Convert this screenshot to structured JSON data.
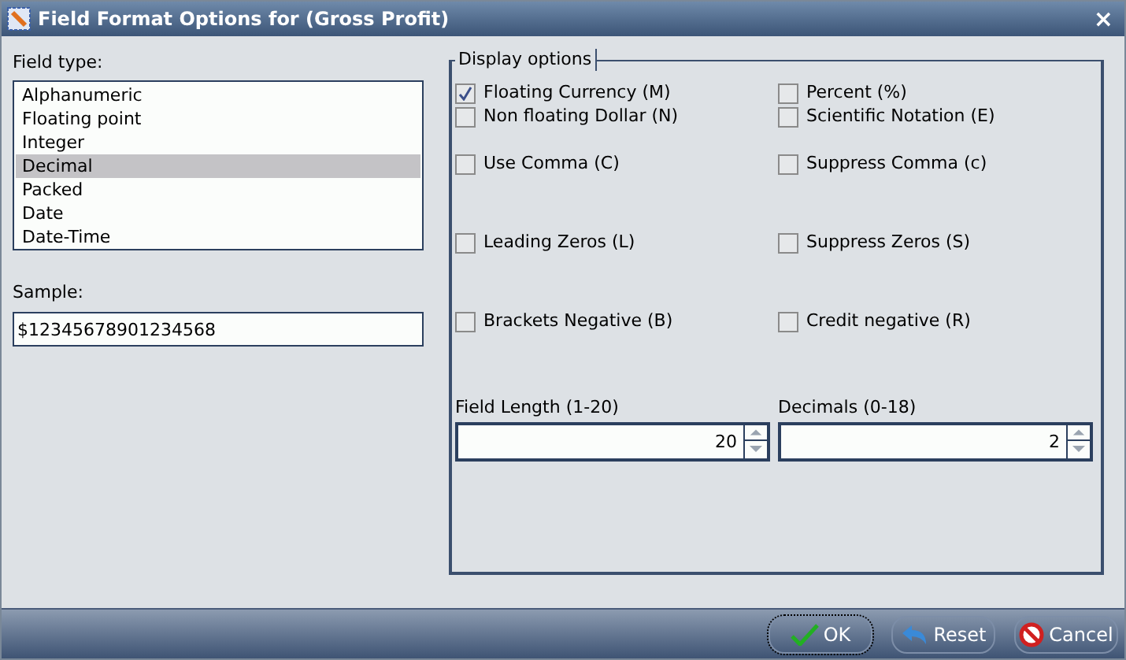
{
  "window": {
    "title": "Field Format Options for (Gross Profit)",
    "close": "×"
  },
  "field_type": {
    "label": "Field type:",
    "items": [
      {
        "label": "Alphanumeric",
        "selected": false
      },
      {
        "label": "Floating point",
        "selected": false
      },
      {
        "label": "Integer",
        "selected": false
      },
      {
        "label": "Decimal",
        "selected": true
      },
      {
        "label": "Packed",
        "selected": false
      },
      {
        "label": "Date",
        "selected": false
      },
      {
        "label": "Date-Time",
        "selected": false
      }
    ]
  },
  "sample": {
    "label": "Sample:",
    "value": "$12345678901234568"
  },
  "display_options": {
    "title": "Display options",
    "rows": [
      [
        {
          "label": "Floating Currency (M)",
          "checked": true
        },
        {
          "label": "Percent (%)",
          "checked": false
        }
      ],
      [
        {
          "label": "Non floating Dollar (N)",
          "checked": false
        },
        {
          "label": "Scientific Notation (E)",
          "checked": false
        }
      ],
      [
        {
          "label": "Use Comma (C)",
          "checked": false
        },
        {
          "label": "Suppress Comma (c)",
          "checked": false
        }
      ],
      [
        {
          "label": "Leading Zeros (L)",
          "checked": false
        },
        {
          "label": "Suppress Zeros (S)",
          "checked": false
        }
      ],
      [
        {
          "label": "Brackets Negative (B)",
          "checked": false
        },
        {
          "label": "Credit negative (R)",
          "checked": false
        }
      ]
    ],
    "spinners": [
      {
        "label": "Field Length (1-20)",
        "value": "20"
      },
      {
        "label": "Decimals (0-18)",
        "value": "2"
      }
    ]
  },
  "buttons": [
    {
      "label": "OK",
      "kind": "ok",
      "focused": true
    },
    {
      "label": "Reset",
      "kind": "reset",
      "focused": false
    },
    {
      "label": "Cancel",
      "kind": "cancel",
      "focused": false
    }
  ]
}
